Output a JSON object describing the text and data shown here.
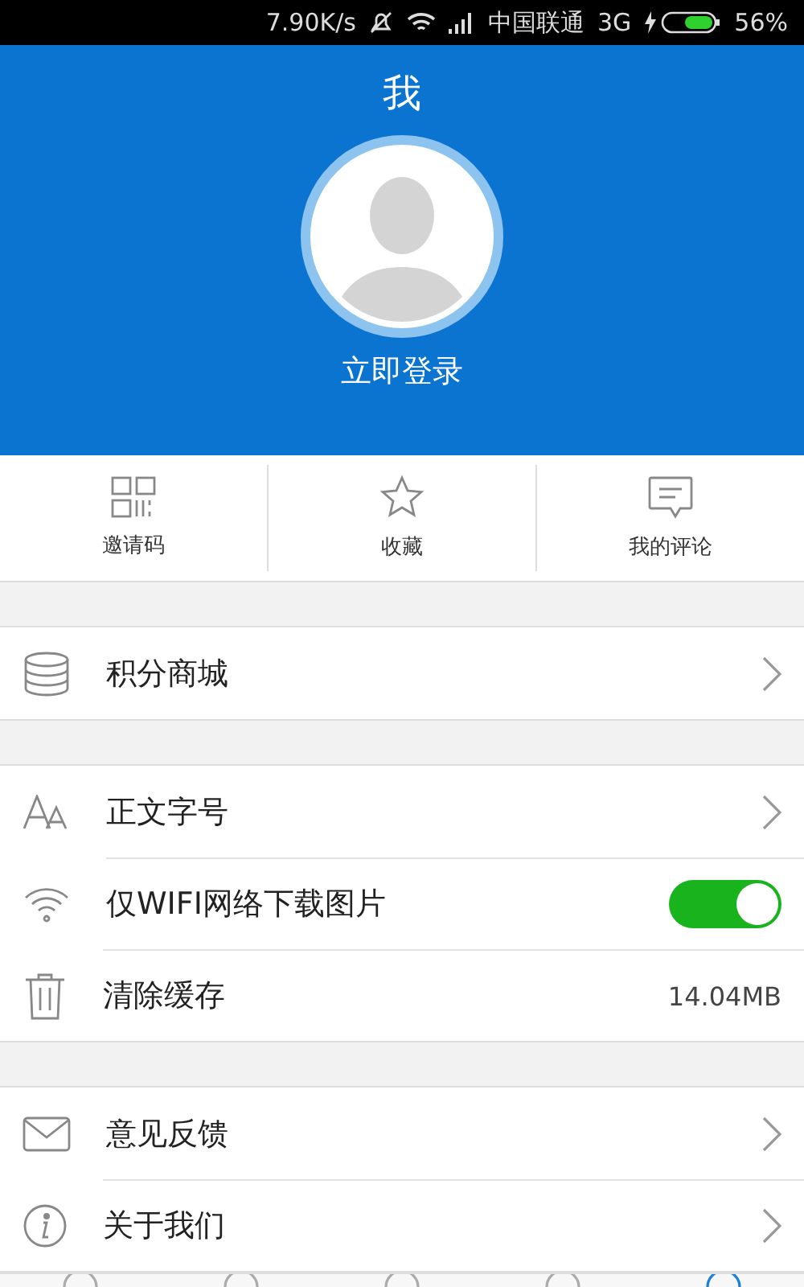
{
  "status_bar": {
    "speed": "7.90K/s",
    "carrier": "中国联通",
    "network": "3G",
    "battery": "56%"
  },
  "header": {
    "title": "我",
    "login": "立即登录"
  },
  "shortcuts": [
    {
      "label": "邀请码"
    },
    {
      "label": "收藏"
    },
    {
      "label": "我的评论"
    }
  ],
  "sections": [
    {
      "items": [
        {
          "kind": "link",
          "label": "积分商城"
        }
      ]
    },
    {
      "items": [
        {
          "kind": "link",
          "label": "正文字号"
        },
        {
          "kind": "toggle",
          "label": "仅WIFI网络下载图片",
          "on": true
        },
        {
          "kind": "value",
          "label": "清除缓存",
          "value": "14.04MB"
        }
      ]
    },
    {
      "items": [
        {
          "kind": "link",
          "label": "意见反馈"
        },
        {
          "kind": "link",
          "label": "关于我们"
        }
      ]
    }
  ],
  "bottom_tabs": [
    {
      "selected": false
    },
    {
      "selected": false
    },
    {
      "selected": false
    },
    {
      "selected": false
    },
    {
      "selected": true
    }
  ]
}
